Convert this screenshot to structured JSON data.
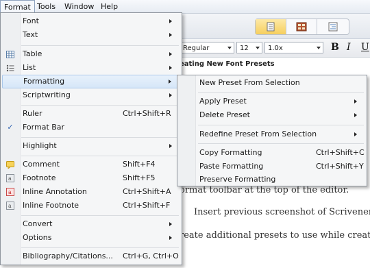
{
  "menubar": {
    "items": [
      "Format",
      "Tools",
      "Window",
      "Help"
    ]
  },
  "editor": {
    "font_style": "Regular",
    "font_size": "12",
    "line_spacing": "1.0x",
    "bold_label": "B",
    "italic_label": "I",
    "underline_label": "U",
    "heading_text": "eating New Font Presets",
    "lines": [
      "ormat toolbar at the top of the editor.",
      "Insert previous screenshot of Scrivener",
      "reate additional presets to use while creat"
    ]
  },
  "format_menu": {
    "items": [
      {
        "label": "Font",
        "submenu": true
      },
      {
        "label": "Text",
        "submenu": true
      },
      {
        "label": "Table",
        "submenu": true,
        "icon": "table-icon"
      },
      {
        "label": "List",
        "submenu": true,
        "icon": "list-icon"
      },
      {
        "label": "Formatting",
        "submenu": true
      },
      {
        "label": "Scriptwriting",
        "submenu": true
      },
      {
        "label": "Ruler",
        "shortcut": "Ctrl+Shift+R"
      },
      {
        "label": "Format Bar",
        "icon": "checkmark-icon"
      },
      {
        "label": "Highlight",
        "submenu": true
      },
      {
        "label": "Comment",
        "shortcut": "Shift+F4",
        "icon": "comment-icon"
      },
      {
        "label": "Footnote",
        "shortcut": "Shift+F5",
        "icon": "footnote-icon"
      },
      {
        "label": "Inline Annotation",
        "shortcut": "Ctrl+Shift+A",
        "icon": "inline-annotation-icon"
      },
      {
        "label": "Inline Footnote",
        "shortcut": "Ctrl+Shift+F",
        "icon": "inline-footnote-icon"
      },
      {
        "label": "Convert",
        "submenu": true
      },
      {
        "label": "Options",
        "submenu": true
      },
      {
        "label": "Bibliography/Citations...",
        "shortcut": "Ctrl+G, Ctrl+O"
      }
    ]
  },
  "formatting_submenu": {
    "items": [
      {
        "label": "New Preset From Selection"
      },
      {
        "label": "Apply Preset",
        "submenu": true
      },
      {
        "label": "Delete Preset",
        "submenu": true
      },
      {
        "label": "Redefine Preset From Selection",
        "submenu": true
      },
      {
        "label": "Copy Formatting",
        "shortcut": "Ctrl+Shift+C"
      },
      {
        "label": "Paste Formatting",
        "shortcut": "Ctrl+Shift+Y"
      },
      {
        "label": "Preserve Formatting"
      }
    ]
  }
}
